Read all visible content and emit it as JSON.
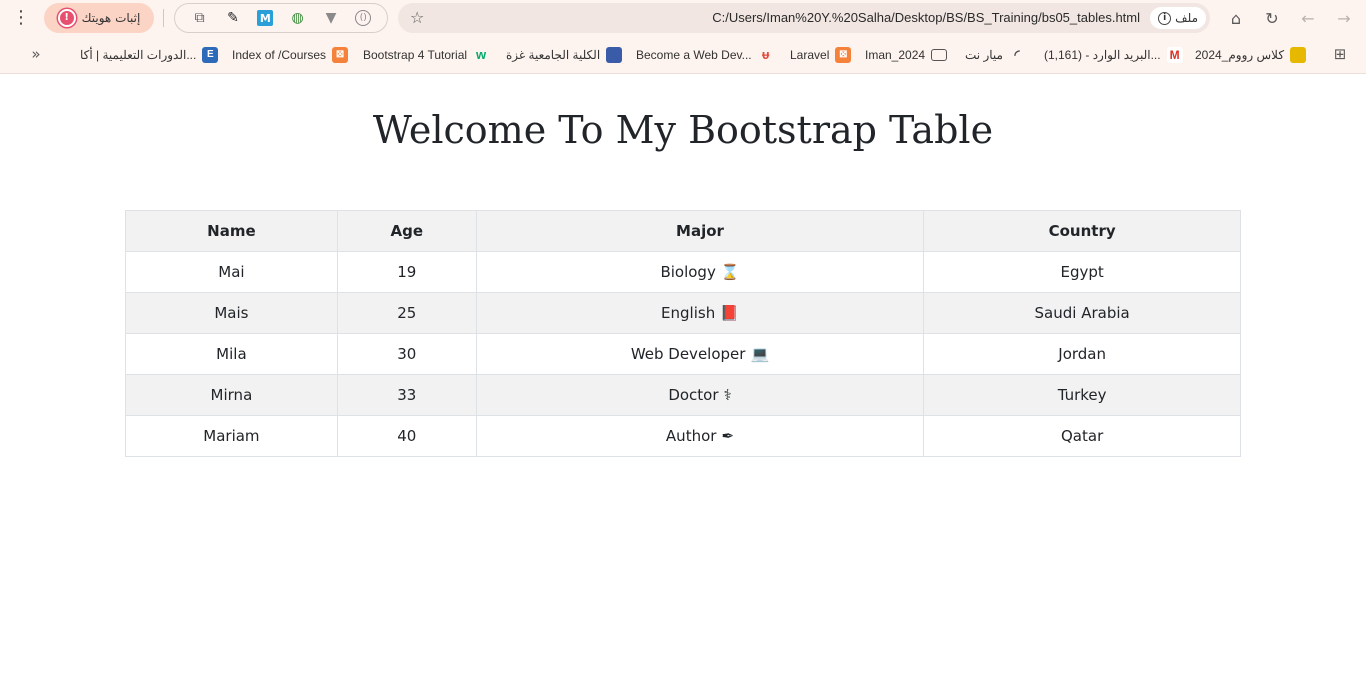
{
  "browser": {
    "url": "C:/Users/Iman%20Y.%20Salha/Desktop/BS/BS_Training/bs05_tables.html",
    "chip_label": "ملف",
    "profile_label": "إثبات هويتك",
    "profile_badge": "!",
    "extensions": [
      "puzzle-icon",
      "eyedropper-icon",
      "m-extension-icon",
      "globe-icon",
      "v-extension-icon",
      "circle-extension-icon"
    ],
    "m_ext_letter": "M",
    "o_ext_letter": "()"
  },
  "bookmarks": [
    {
      "label": "كلاس رووم_2024",
      "icon": "classroom-icon",
      "color": "#e6b800"
    },
    {
      "label": "البريد الوارد - (1,161)...",
      "icon": "gmail-icon",
      "color": "#d93025"
    },
    {
      "label": "ميار نت",
      "icon": "wifi-icon",
      "color": "#444444"
    },
    {
      "label": "Iman_2024",
      "icon": "folder-icon",
      "color": "#555555"
    },
    {
      "label": "Laravel",
      "icon": "xampp-icon",
      "color": "#f5823a"
    },
    {
      "label": "Become a Web Dev...",
      "icon": "udemy-icon",
      "color": "#e5493a"
    },
    {
      "label": "الكلية الجامعية غزة",
      "icon": "college-icon",
      "color": "#3a5ca8"
    },
    {
      "label": "Bootstrap 4 Tutorial",
      "icon": "w3schools-icon",
      "color": "#04aa6d"
    },
    {
      "label": "Index of /Courses",
      "icon": "xampp-icon",
      "color": "#f5823a"
    },
    {
      "label": "الدورات التعليمية | أكا...",
      "icon": "edraak-icon",
      "color": "#2d6ab8"
    }
  ],
  "bookmark_e": "E",
  "page": {
    "title": "Welcome To My Bootstrap Table"
  },
  "table": {
    "headers": [
      "Name",
      "Age",
      "Major",
      "Country"
    ],
    "rows": [
      {
        "name": "Mai",
        "age": "19",
        "major": "Biology",
        "major_icon": "dna-icon",
        "glyph": "⌛",
        "country": "Egypt"
      },
      {
        "name": "Mais",
        "age": "25",
        "major": "English",
        "major_icon": "book-icon",
        "glyph": "📕",
        "country": "Saudi Arabia"
      },
      {
        "name": "Mila",
        "age": "30",
        "major": "Web Developer",
        "major_icon": "laptop-code-icon",
        "glyph": "💻",
        "country": "Jordan"
      },
      {
        "name": "Mirna",
        "age": "33",
        "major": "Doctor",
        "major_icon": "stethoscope-icon",
        "glyph": "⚕",
        "country": "Turkey"
      },
      {
        "name": "Mariam",
        "age": "40",
        "major": "Author",
        "major_icon": "pen-icon",
        "glyph": "✒",
        "country": "Qatar"
      }
    ]
  },
  "colors": {
    "chrome_bg": "#fdf3ef",
    "address_bg": "#f1e6e2",
    "profile_bg": "#fbd4c6",
    "stripe": "#f2f2f2",
    "border": "#dee2e6"
  }
}
